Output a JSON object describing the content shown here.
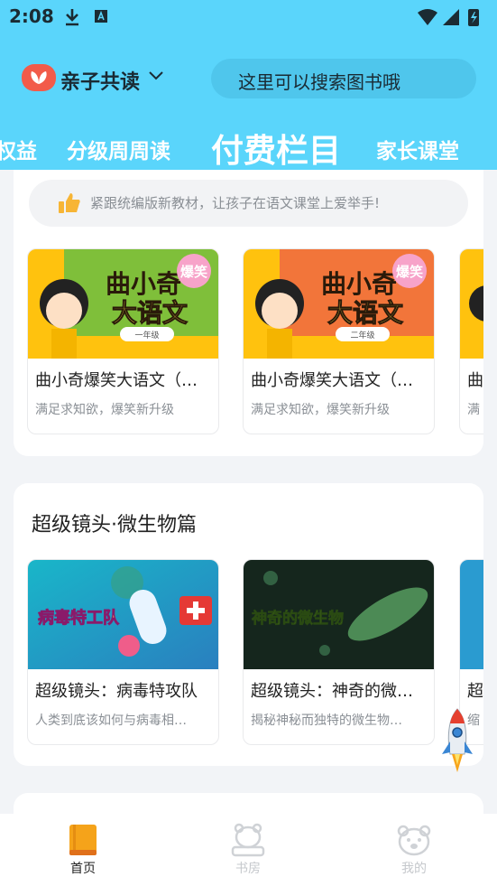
{
  "status_bar": {
    "time": "2:08"
  },
  "header": {
    "app_title": "亲子共读",
    "search_placeholder": "这里可以搜索图书哦",
    "tabs": [
      {
        "label": "权益"
      },
      {
        "label": "分级周周读"
      },
      {
        "label": "付费栏目",
        "active": true
      },
      {
        "label": "家长课堂"
      }
    ],
    "background_color": "#5ad5fb"
  },
  "section1": {
    "notice": "紧跟统编版新教材，让孩子在语文课堂上爱举手!",
    "books": [
      {
        "title": "曲小奇爆笑大语文（…",
        "subtitle": "满足求知欲，爆笑新升级",
        "cover_title": "曲小奇",
        "cover_title2": "大语文",
        "cover_badge": "爆笑",
        "cover_grade": "一年级"
      },
      {
        "title": "曲小奇爆笑大语文（…",
        "subtitle": "满足求知欲，爆笑新升级",
        "cover_title": "曲小奇",
        "cover_title2": "大语文",
        "cover_badge": "爆笑",
        "cover_grade": "二年级"
      },
      {
        "title": "曲",
        "subtitle": "满"
      }
    ]
  },
  "section2": {
    "title": "超级镜头·微生物篇",
    "books": [
      {
        "title": "超级镜头：病毒特攻队",
        "subtitle": "人类到底该如何与病毒相…",
        "cover_text": "病毒特工队"
      },
      {
        "title": "超级镜头：神奇的微…",
        "subtitle": "揭秘神秘而独特的微生物…",
        "cover_text": "神奇的微生物"
      },
      {
        "title": "超",
        "subtitle": "缩"
      }
    ]
  },
  "tabbar": {
    "items": [
      {
        "label": "首页",
        "icon": "book-icon",
        "active": true
      },
      {
        "label": "书房",
        "icon": "bear-desk-icon"
      },
      {
        "label": "我的",
        "icon": "bear-face-icon"
      }
    ]
  }
}
